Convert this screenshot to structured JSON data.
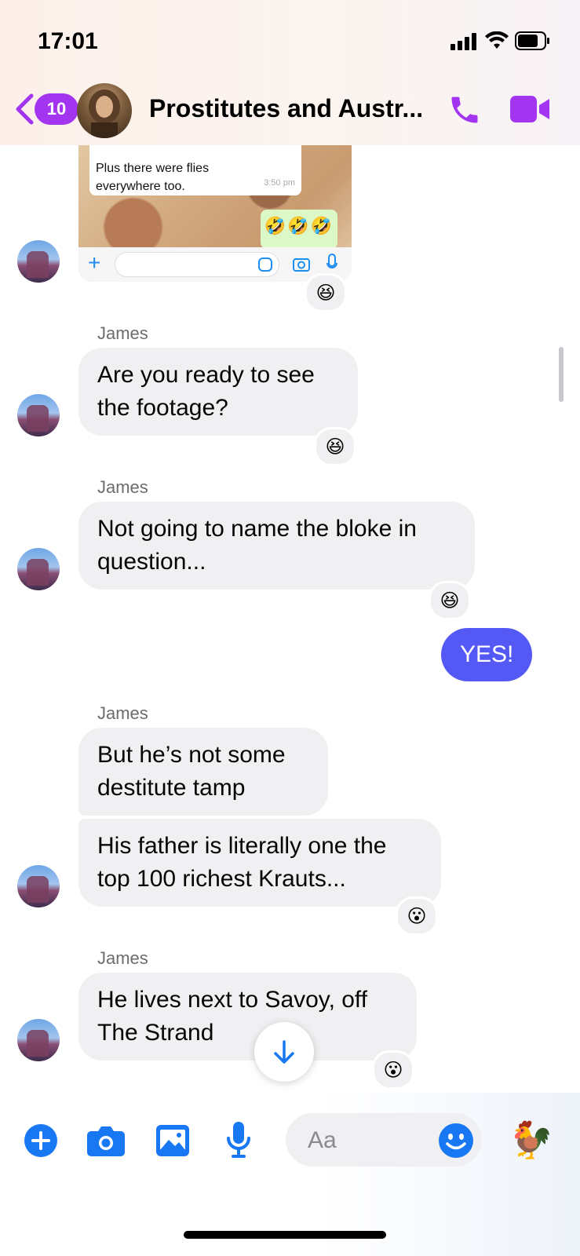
{
  "status_bar": {
    "time": "17:01"
  },
  "header": {
    "back_badge": "10",
    "title": "Prostitutes and Austr...",
    "accent_color": "#a335f0"
  },
  "shared_image": {
    "message_text_line1": "Plus there were flies",
    "message_text_line2": "everywhere too.",
    "message_time": "3:50 pm",
    "emoji_reply": "🤣🤣🤣",
    "reaction": "😆"
  },
  "messages": [
    {
      "sender": "James",
      "text_lines": [
        "Are you ready to see",
        "the footage?"
      ],
      "reaction": "😆"
    },
    {
      "sender": "James",
      "text_lines": [
        "Not going to name the bloke in",
        "question..."
      ],
      "reaction": "😆"
    },
    {
      "outgoing_text": "YES!"
    },
    {
      "sender": "James",
      "text_lines": [
        "But he’s not some",
        "destitute tamp"
      ]
    },
    {
      "text_lines": [
        "His father is literally one the",
        "top 100 richest Krauts..."
      ],
      "reaction": "😮"
    },
    {
      "sender": "James",
      "text_lines": [
        "He lives next to Savoy, off",
        "The Strand"
      ],
      "reaction": "😮"
    }
  ],
  "composer": {
    "placeholder": "Aa",
    "quick_reaction": "🐓",
    "icons": [
      "plus-icon",
      "camera-icon",
      "gallery-icon",
      "microphone-icon",
      "emoji-icon"
    ],
    "accent_color": "#1877f2"
  },
  "colors": {
    "outgoing_bubble": "#5458f5",
    "incoming_bubble": "#f0f0f2"
  }
}
